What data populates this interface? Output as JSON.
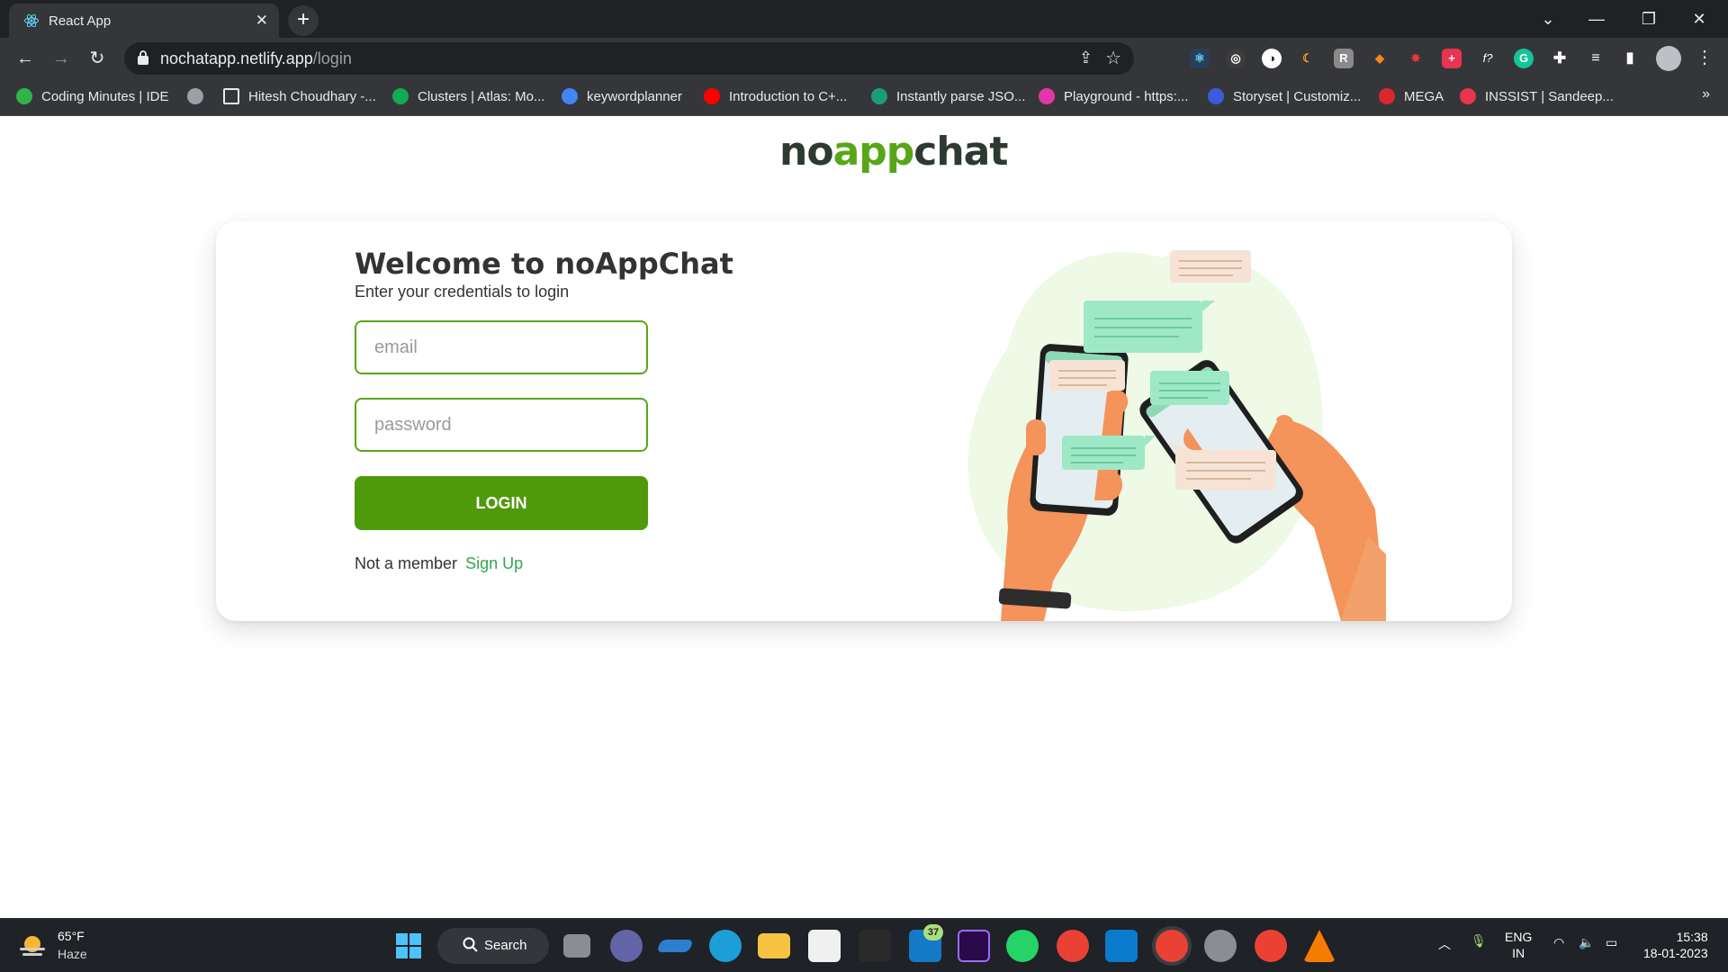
{
  "browser": {
    "tab_title": "React App",
    "url_host": "nochatapp.netlify.app",
    "url_path": "/login",
    "bookmarks": [
      {
        "label": "Coding Minutes | IDE",
        "color": "#2fb44a"
      },
      {
        "label": "",
        "color": "#9aa0a6"
      },
      {
        "label": "Hitesh Choudhary -...",
        "color": "#000000"
      },
      {
        "label": "Clusters | Atlas: Mo...",
        "color": "#13aa52"
      },
      {
        "label": "keywordplanner",
        "color": "#4285f4"
      },
      {
        "label": "Introduction to C+...",
        "color": "#ff0000"
      },
      {
        "label": "Instantly parse JSO...",
        "color": "#1a9c7b"
      },
      {
        "label": "Playground - https:...",
        "color": "#e535ab"
      },
      {
        "label": "Storyset | Customiz...",
        "color": "#3b5bdb"
      },
      {
        "label": "MEGA",
        "color": "#d9272e"
      },
      {
        "label": "INSSIST | Sandeep...",
        "color": "#e8344e"
      }
    ]
  },
  "page": {
    "brand": {
      "part1": "no",
      "part2": "app",
      "part3": "chat"
    },
    "welcome_title": "Welcome to noAppChat",
    "subtitle": "Enter your credentials to login",
    "email_placeholder": "email",
    "password_placeholder": "password",
    "login_label": "LOGIN",
    "member_text": "Not a member",
    "signup_link": "Sign Up",
    "accent_color": "#58a618"
  },
  "taskbar": {
    "weather_temp": "65°F",
    "weather_cond": "Haze",
    "search_label": "Search",
    "mail_badge": "37",
    "lang_top": "ENG",
    "lang_bottom": "IN",
    "time": "15:38",
    "date": "18-01-2023"
  }
}
